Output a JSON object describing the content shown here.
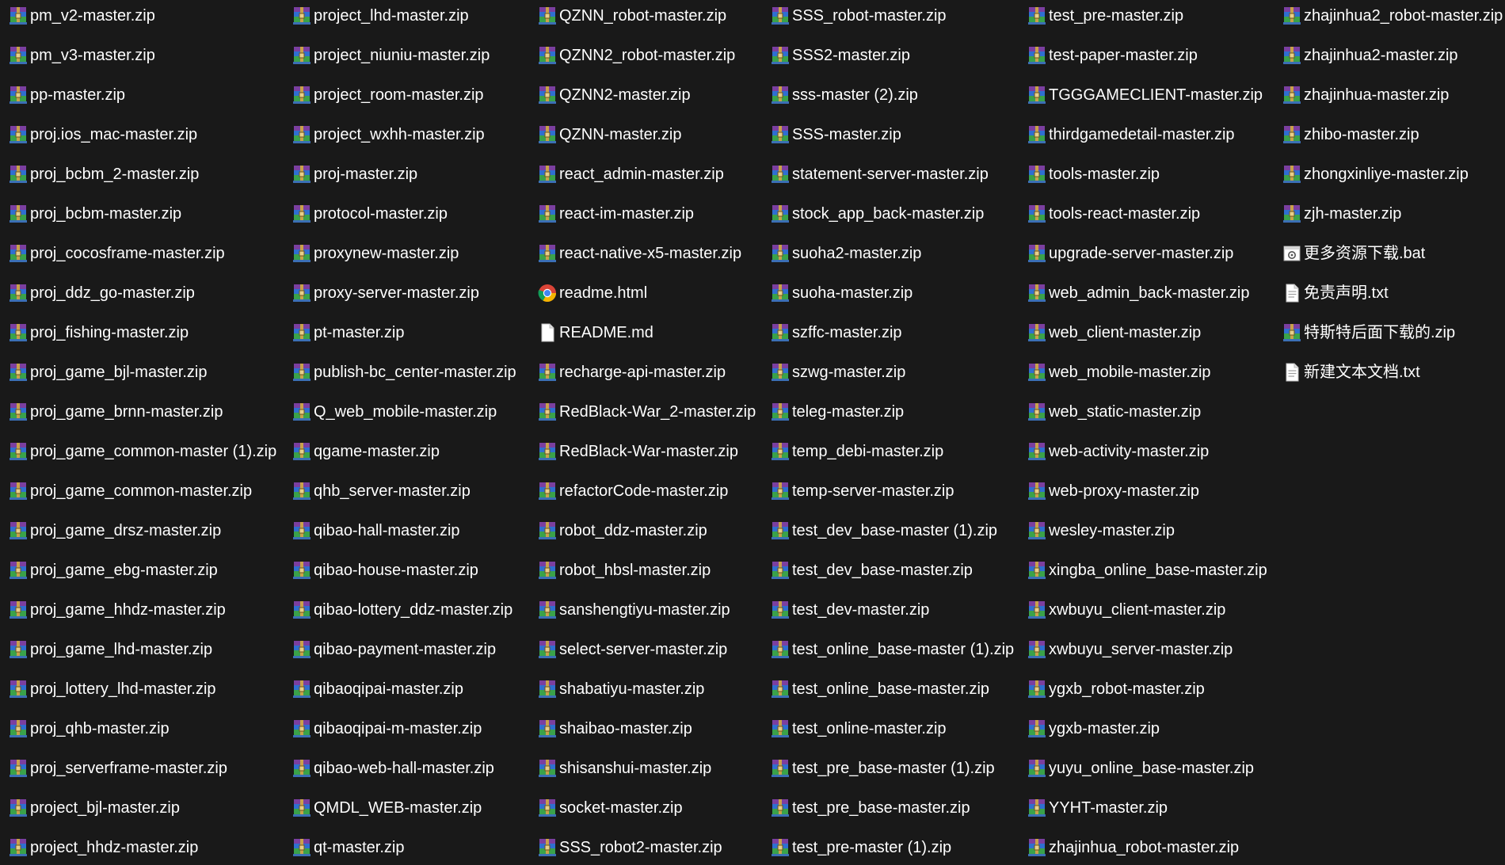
{
  "window": {
    "background": "#191919",
    "text_color": "#ffffff"
  },
  "file_list": {
    "columns": [
      {
        "items": [
          {
            "name": "pm_v2-master.zip",
            "icon": "archive-icon"
          },
          {
            "name": "pm_v3-master.zip",
            "icon": "archive-icon"
          },
          {
            "name": "pp-master.zip",
            "icon": "archive-icon"
          },
          {
            "name": "proj.ios_mac-master.zip",
            "icon": "archive-icon"
          },
          {
            "name": "proj_bcbm_2-master.zip",
            "icon": "archive-icon"
          },
          {
            "name": "proj_bcbm-master.zip",
            "icon": "archive-icon"
          },
          {
            "name": "proj_cocosframe-master.zip",
            "icon": "archive-icon"
          },
          {
            "name": "proj_ddz_go-master.zip",
            "icon": "archive-icon"
          },
          {
            "name": "proj_fishing-master.zip",
            "icon": "archive-icon"
          },
          {
            "name": "proj_game_bjl-master.zip",
            "icon": "archive-icon"
          },
          {
            "name": "proj_game_brnn-master.zip",
            "icon": "archive-icon"
          },
          {
            "name": "proj_game_common-master (1).zip",
            "icon": "archive-icon"
          },
          {
            "name": "proj_game_common-master.zip",
            "icon": "archive-icon"
          },
          {
            "name": "proj_game_drsz-master.zip",
            "icon": "archive-icon"
          },
          {
            "name": "proj_game_ebg-master.zip",
            "icon": "archive-icon"
          },
          {
            "name": "proj_game_hhdz-master.zip",
            "icon": "archive-icon"
          },
          {
            "name": "proj_game_lhd-master.zip",
            "icon": "archive-icon"
          },
          {
            "name": "proj_lottery_lhd-master.zip",
            "icon": "archive-icon"
          },
          {
            "name": "proj_qhb-master.zip",
            "icon": "archive-icon"
          },
          {
            "name": "proj_serverframe-master.zip",
            "icon": "archive-icon"
          },
          {
            "name": "project_bjl-master.zip",
            "icon": "archive-icon"
          },
          {
            "name": "project_hhdz-master.zip",
            "icon": "archive-icon"
          }
        ]
      },
      {
        "items": [
          {
            "name": "project_lhd-master.zip",
            "icon": "archive-icon"
          },
          {
            "name": "project_niuniu-master.zip",
            "icon": "archive-icon"
          },
          {
            "name": "project_room-master.zip",
            "icon": "archive-icon"
          },
          {
            "name": "project_wxhh-master.zip",
            "icon": "archive-icon"
          },
          {
            "name": "proj-master.zip",
            "icon": "archive-icon"
          },
          {
            "name": "protocol-master.zip",
            "icon": "archive-icon"
          },
          {
            "name": "proxynew-master.zip",
            "icon": "archive-icon"
          },
          {
            "name": "proxy-server-master.zip",
            "icon": "archive-icon"
          },
          {
            "name": "pt-master.zip",
            "icon": "archive-icon"
          },
          {
            "name": "publish-bc_center-master.zip",
            "icon": "archive-icon"
          },
          {
            "name": "Q_web_mobile-master.zip",
            "icon": "archive-icon"
          },
          {
            "name": "qgame-master.zip",
            "icon": "archive-icon"
          },
          {
            "name": "qhb_server-master.zip",
            "icon": "archive-icon"
          },
          {
            "name": "qibao-hall-master.zip",
            "icon": "archive-icon"
          },
          {
            "name": "qibao-house-master.zip",
            "icon": "archive-icon"
          },
          {
            "name": "qibao-lottery_ddz-master.zip",
            "icon": "archive-icon"
          },
          {
            "name": "qibao-payment-master.zip",
            "icon": "archive-icon"
          },
          {
            "name": "qibaoqipai-master.zip",
            "icon": "archive-icon"
          },
          {
            "name": "qibaoqipai-m-master.zip",
            "icon": "archive-icon"
          },
          {
            "name": "qibao-web-hall-master.zip",
            "icon": "archive-icon"
          },
          {
            "name": "QMDL_WEB-master.zip",
            "icon": "archive-icon"
          },
          {
            "name": "qt-master.zip",
            "icon": "archive-icon"
          }
        ]
      },
      {
        "items": [
          {
            "name": "QZNN_robot-master.zip",
            "icon": "archive-icon"
          },
          {
            "name": "QZNN2_robot-master.zip",
            "icon": "archive-icon"
          },
          {
            "name": "QZNN2-master.zip",
            "icon": "archive-icon"
          },
          {
            "name": "QZNN-master.zip",
            "icon": "archive-icon"
          },
          {
            "name": "react_admin-master.zip",
            "icon": "archive-icon"
          },
          {
            "name": "react-im-master.zip",
            "icon": "archive-icon"
          },
          {
            "name": "react-native-x5-master.zip",
            "icon": "archive-icon"
          },
          {
            "name": "readme.html",
            "icon": "chrome-icon"
          },
          {
            "name": "README.md",
            "icon": "document-icon"
          },
          {
            "name": "recharge-api-master.zip",
            "icon": "archive-icon"
          },
          {
            "name": "RedBlack-War_2-master.zip",
            "icon": "archive-icon"
          },
          {
            "name": "RedBlack-War-master.zip",
            "icon": "archive-icon"
          },
          {
            "name": "refactorCode-master.zip",
            "icon": "archive-icon"
          },
          {
            "name": "robot_ddz-master.zip",
            "icon": "archive-icon"
          },
          {
            "name": "robot_hbsl-master.zip",
            "icon": "archive-icon"
          },
          {
            "name": "sanshengtiyu-master.zip",
            "icon": "archive-icon"
          },
          {
            "name": "select-server-master.zip",
            "icon": "archive-icon"
          },
          {
            "name": "shabatiyu-master.zip",
            "icon": "archive-icon"
          },
          {
            "name": "shaibao-master.zip",
            "icon": "archive-icon"
          },
          {
            "name": "shisanshui-master.zip",
            "icon": "archive-icon"
          },
          {
            "name": "socket-master.zip",
            "icon": "archive-icon"
          },
          {
            "name": "SSS_robot2-master.zip",
            "icon": "archive-icon"
          }
        ]
      },
      {
        "items": [
          {
            "name": "SSS_robot-master.zip",
            "icon": "archive-icon"
          },
          {
            "name": "SSS2-master.zip",
            "icon": "archive-icon"
          },
          {
            "name": "sss-master (2).zip",
            "icon": "archive-icon"
          },
          {
            "name": "SSS-master.zip",
            "icon": "archive-icon"
          },
          {
            "name": "statement-server-master.zip",
            "icon": "archive-icon"
          },
          {
            "name": "stock_app_back-master.zip",
            "icon": "archive-icon"
          },
          {
            "name": "suoha2-master.zip",
            "icon": "archive-icon"
          },
          {
            "name": "suoha-master.zip",
            "icon": "archive-icon"
          },
          {
            "name": "szffc-master.zip",
            "icon": "archive-icon"
          },
          {
            "name": "szwg-master.zip",
            "icon": "archive-icon"
          },
          {
            "name": "teleg-master.zip",
            "icon": "archive-icon"
          },
          {
            "name": "temp_debi-master.zip",
            "icon": "archive-icon"
          },
          {
            "name": "temp-server-master.zip",
            "icon": "archive-icon"
          },
          {
            "name": "test_dev_base-master (1).zip",
            "icon": "archive-icon"
          },
          {
            "name": "test_dev_base-master.zip",
            "icon": "archive-icon"
          },
          {
            "name": "test_dev-master.zip",
            "icon": "archive-icon"
          },
          {
            "name": "test_online_base-master (1).zip",
            "icon": "archive-icon"
          },
          {
            "name": "test_online_base-master.zip",
            "icon": "archive-icon"
          },
          {
            "name": "test_online-master.zip",
            "icon": "archive-icon"
          },
          {
            "name": "test_pre_base-master (1).zip",
            "icon": "archive-icon"
          },
          {
            "name": "test_pre_base-master.zip",
            "icon": "archive-icon"
          },
          {
            "name": "test_pre-master (1).zip",
            "icon": "archive-icon"
          }
        ]
      },
      {
        "items": [
          {
            "name": "test_pre-master.zip",
            "icon": "archive-icon"
          },
          {
            "name": "test-paper-master.zip",
            "icon": "archive-icon"
          },
          {
            "name": "TGGGAMECLIENT-master.zip",
            "icon": "archive-icon"
          },
          {
            "name": "thirdgamedetail-master.zip",
            "icon": "archive-icon"
          },
          {
            "name": "tools-master.zip",
            "icon": "archive-icon"
          },
          {
            "name": "tools-react-master.zip",
            "icon": "archive-icon"
          },
          {
            "name": "upgrade-server-master.zip",
            "icon": "archive-icon"
          },
          {
            "name": "web_admin_back-master.zip",
            "icon": "archive-icon"
          },
          {
            "name": "web_client-master.zip",
            "icon": "archive-icon"
          },
          {
            "name": "web_mobile-master.zip",
            "icon": "archive-icon"
          },
          {
            "name": "web_static-master.zip",
            "icon": "archive-icon"
          },
          {
            "name": "web-activity-master.zip",
            "icon": "archive-icon"
          },
          {
            "name": "web-proxy-master.zip",
            "icon": "archive-icon"
          },
          {
            "name": "wesley-master.zip",
            "icon": "archive-icon"
          },
          {
            "name": "xingba_online_base-master.zip",
            "icon": "archive-icon"
          },
          {
            "name": "xwbuyu_client-master.zip",
            "icon": "archive-icon"
          },
          {
            "name": "xwbuyu_server-master.zip",
            "icon": "archive-icon"
          },
          {
            "name": "ygxb_robot-master.zip",
            "icon": "archive-icon"
          },
          {
            "name": "ygxb-master.zip",
            "icon": "archive-icon"
          },
          {
            "name": "yuyu_online_base-master.zip",
            "icon": "archive-icon"
          },
          {
            "name": "YYHT-master.zip",
            "icon": "archive-icon"
          },
          {
            "name": "zhajinhua_robot-master.zip",
            "icon": "archive-icon"
          }
        ]
      },
      {
        "items": [
          {
            "name": "zhajinhua2_robot-master.zip",
            "icon": "archive-icon"
          },
          {
            "name": "zhajinhua2-master.zip",
            "icon": "archive-icon"
          },
          {
            "name": "zhajinhua-master.zip",
            "icon": "archive-icon"
          },
          {
            "name": "zhibo-master.zip",
            "icon": "archive-icon"
          },
          {
            "name": "zhongxinliye-master.zip",
            "icon": "archive-icon"
          },
          {
            "name": "zjh-master.zip",
            "icon": "archive-icon"
          },
          {
            "name": "更多资源下载.bat",
            "icon": "batch-file-icon"
          },
          {
            "name": "免责声明.txt",
            "icon": "text-file-icon"
          },
          {
            "name": "特斯特后面下载的.zip",
            "icon": "archive-icon"
          },
          {
            "name": "新建文本文档.txt",
            "icon": "text-file-icon"
          }
        ]
      }
    ]
  }
}
